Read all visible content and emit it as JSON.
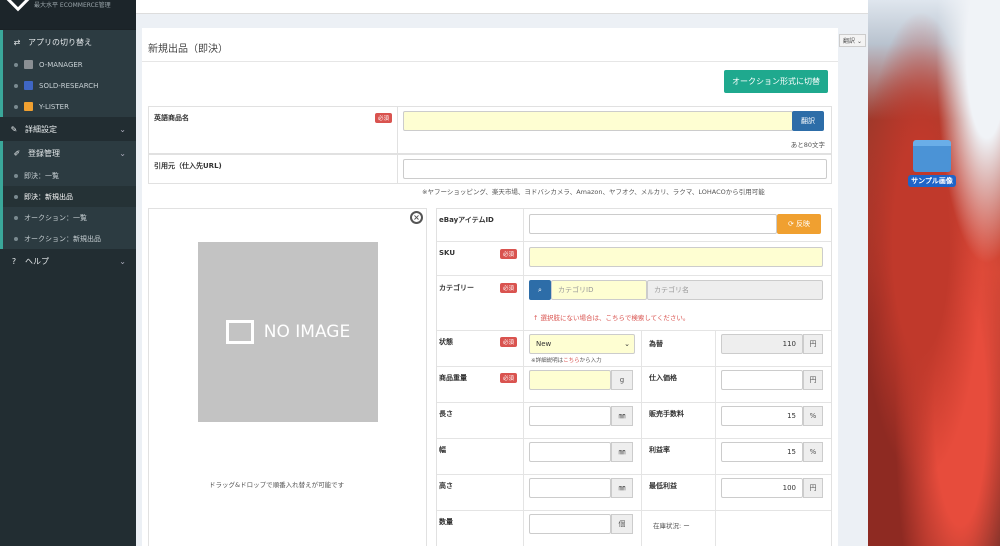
{
  "sidebar": {
    "logo_text": "最大水平 ECOMMERCE管理",
    "app_switch": "アプリの切り替え",
    "apps": [
      {
        "label": "O-MANAGER",
        "color": "#8a8f93"
      },
      {
        "label": "SOLD-RESEARCH",
        "color": "#3f66c4"
      },
      {
        "label": "Y-LISTER",
        "color": "#f0a030"
      }
    ],
    "settings": "詳細設定",
    "registration": "登録管理",
    "reg_items": [
      "即決：一覧",
      "即決：新規出品",
      "オークション：一覧",
      "オークション：新規出品"
    ],
    "help": "ヘルプ"
  },
  "translate_widget": "翻訳",
  "page": {
    "title": "新規出品（即決）",
    "switch_button": "オークション形式に切替",
    "english_title_label": "英語商品名",
    "required": "必須",
    "translate_button": "翻訳",
    "remaining": "あと80文字",
    "source_label": "引用元（仕入先URL)",
    "source_note": "※ヤフーショッピング、楽天市場、ヨドバシカメラ、Amazon、ヤフオク、メルカリ、ラクマ、LOHACOから引用可能",
    "noimage": "NO IMAGE",
    "drag_note": "ドラッグ&ドロップで順番入れ替えが可能です"
  },
  "details": {
    "ebay_id_label": "eBayアイテムID",
    "reflect_button": "反映",
    "sku_label": "SKU",
    "category_label": "カテゴリー",
    "category_id_ph": "カテゴリID",
    "category_name_ph": "カテゴリ名",
    "category_note": "↑ 選択肢にない場合は、こちらで検索してください。",
    "condition_label": "状態",
    "condition_value": "New",
    "condition_note_pre": "※詳細説明は",
    "condition_note_link": "こちら",
    "condition_note_post": "から入力",
    "fx_label": "為替",
    "fx_value": "110",
    "fx_unit": "円",
    "weight_label": "商品重量",
    "weight_unit": "g",
    "cost_label": "仕入価格",
    "cost_unit": "円",
    "length_label": "長さ",
    "length_unit": "㎜",
    "fee_label": "販売手数料",
    "fee_value": "15",
    "fee_unit": "%",
    "width_label": "幅",
    "width_unit": "㎜",
    "profit_label": "利益率",
    "profit_value": "15",
    "profit_unit": "%",
    "height_label": "高さ",
    "height_unit": "㎜",
    "minprofit_label": "最低利益",
    "minprofit_value": "100",
    "minprofit_unit": "円",
    "qty_label": "数量",
    "qty_unit": "個",
    "stock_label": "在庫状況: ー"
  },
  "desktop": {
    "folder_label": "サンプル画像"
  }
}
